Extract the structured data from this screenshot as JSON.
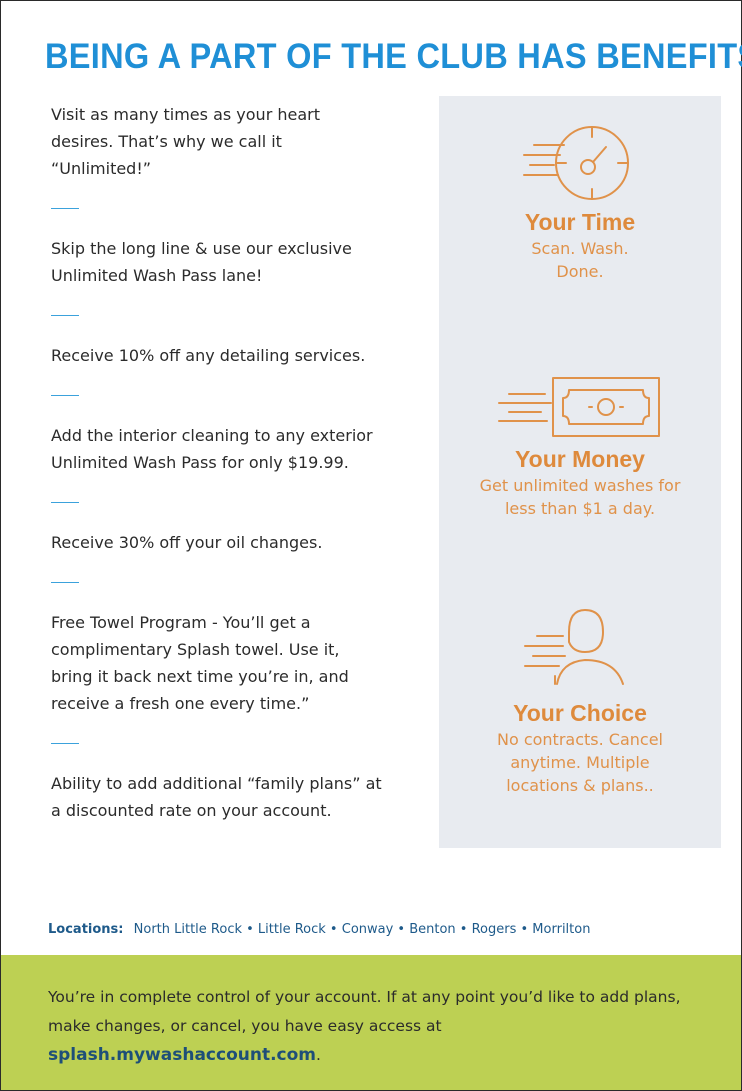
{
  "headline": "BEING A PART OF THE CLUB HAS BENEFITS!",
  "benefits": [
    "Visit as many times as your heart desires. That’s why we call it “Unlimited!”",
    "Skip the long line & use our exclusive Unlimited Wash Pass lane!",
    "Receive 10% off any detailing services.",
    "Add the interior cleaning to any exterior Unlimited Wash Pass for only $19.99.",
    "Receive 30% off your oil changes.",
    "Free Towel Program  - You’ll get a complimentary Splash towel. Use it, bring it back next time you’re in, and receive a fresh one every time.”",
    "Ability to add additional “family plans” at a discounted rate on your account."
  ],
  "features": [
    {
      "icon": "stopwatch-icon",
      "title": "Your Time",
      "desc": "Scan. Wash. Done."
    },
    {
      "icon": "money-bill-icon",
      "title": "Your Money",
      "desc": "Get unlimited washes for less than $1 a day."
    },
    {
      "icon": "person-icon",
      "title": "Your Choice",
      "desc": "No contracts. Cancel anytime. Multiple locations & plans.."
    }
  ],
  "locations": {
    "label": "Locations:",
    "list": "North Little Rock • Little Rock • Conway • Benton • Rogers • Morrilton"
  },
  "footer": {
    "text": "You’re in complete control of your account. If at any point you’d like to add plans, make changes, or cancel, you have easy access at",
    "link": "splash.mywashaccount.com",
    "end": "."
  },
  "colors": {
    "headline": "#1f8fd6",
    "accent_orange": "#de8a3c",
    "sidebar_bg": "#e8ebf0",
    "footer_bg": "#bdd053",
    "divider": "#3ba2dc"
  }
}
